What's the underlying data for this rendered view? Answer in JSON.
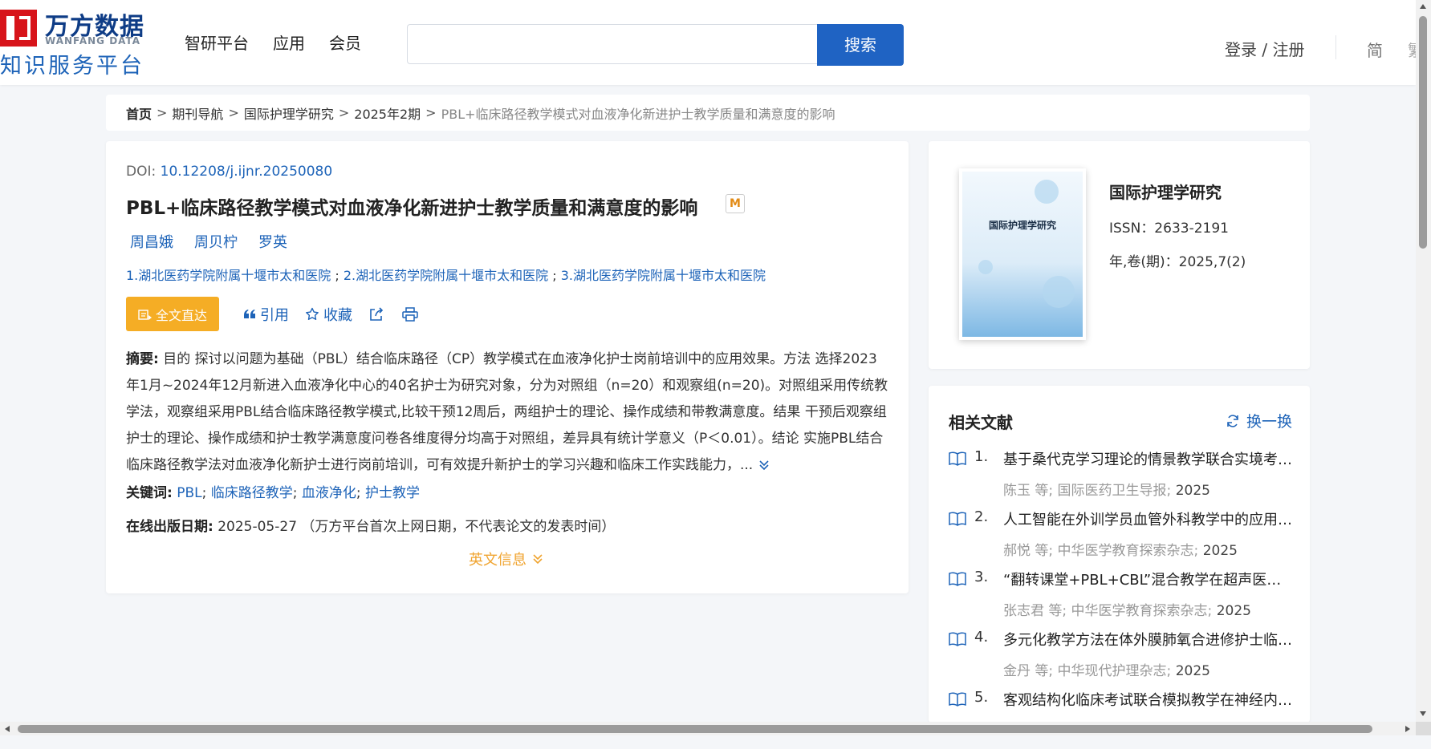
{
  "header": {
    "logo_cn": "万方数据",
    "logo_en": "WANFANG DATA",
    "logo_sub": "知识服务平台",
    "nav": [
      "智研平台",
      "应用",
      "会员"
    ],
    "search_value": "",
    "search_button": "搜索",
    "login": "登录 / 注册",
    "lang_simplified": "简",
    "lang_traditional": "繁"
  },
  "breadcrumb": {
    "home": "首页",
    "items": [
      "期刊导航",
      "国际护理学研究",
      "2025年2期"
    ],
    "current": "PBL+临床路径教学模式对血液净化新进护士教学质量和满意度的影响",
    "separator": ">"
  },
  "article": {
    "doi_label": "DOI:",
    "doi": "10.12208/j.ijnr.20250080",
    "title": "PBL+临床路径教学模式对血液净化新进护士教学质量和满意度的影响",
    "badge": "M",
    "authors": [
      "周昌娥",
      "周贝柠",
      "罗英"
    ],
    "affiliations": [
      "1.湖北医药学院附属十堰市太和医院",
      "2.湖北医药学院附属十堰市太和医院",
      "3.湖北医药学院附属十堰市太和医院"
    ],
    "affil_sep": ";",
    "actions": {
      "fulltext": "全文直达",
      "cite": "引用",
      "favorite": "收藏"
    },
    "abstract_label": "摘要:",
    "abstract_text": "目的 探讨以问题为基础（PBL）结合临床路径（CP）教学模式在血液净化护士岗前培训中的应用效果。方法 选择2023年1月~2024年12月新进入血液净化中心的40名护士为研究对象，分为对照组（n=20）和观察组(n=20)。对照组采用传统教学法，观察组采用PBL结合临床路径教学模式,比较干预12周后，两组护士的理论、操作成绩和带教满意度。结果 干预后观察组护士的理论、操作成绩和护士教学满意度问卷各维度得分均高于对照组，差异具有统计学意义（P＜0.01）。结论 实施PBL结合临床路径教学法对血液净化新护士进行岗前培训，可有效提升新护士的学习兴趣和临床工作实践能力，...",
    "keywords_label": "关键词:",
    "keywords": [
      "PBL",
      "临床路径教学",
      "血液净化",
      "护士教学"
    ],
    "keyword_sep": ";",
    "pubdate_label": "在线出版日期:",
    "pubdate": "2025-05-27",
    "pubdate_note": "（万方平台首次上网日期，不代表论文的发表时间）",
    "english_info": "英文信息"
  },
  "journal": {
    "cover_title": "国际护理学研究",
    "name": "国际护理学研究",
    "issn": "ISSN：2633-2191",
    "volume": "年,卷(期)：2025,7(2)"
  },
  "related": {
    "heading": "相关文献",
    "refresh": "换一换",
    "items": [
      {
        "num": "1.",
        "title": "基于桑代克学习理论的情景教学联合实境考核法在...",
        "authors": "陈玉",
        "etal": "等;",
        "journal": "国际医药卫生导报",
        "year": "2025"
      },
      {
        "num": "2.",
        "title": "人工智能在外训学员血管外科教学中的应用研究",
        "authors": "郝悦",
        "etal": "等;",
        "journal": "中华医学教育探索杂志",
        "year": "2025"
      },
      {
        "num": "3.",
        "title": "“翻转课堂+PBL+CBL”混合教学在超声医学规培中...",
        "authors": "张志君",
        "etal": "等;",
        "journal": "中华医学教育探索杂志",
        "year": "2025"
      },
      {
        "num": "4.",
        "title": "多元化教学方法在体外膜肺氧合进修护士临床带教中...",
        "authors": "金丹",
        "etal": "等;",
        "journal": "中华现代护理杂志",
        "year": "2025"
      },
      {
        "num": "5.",
        "title": "客观结构化临床考试联合模拟教学在神经内科教学中...",
        "authors": "",
        "etal": "",
        "journal": "",
        "year": ""
      }
    ]
  },
  "colors": {
    "brand_red": "#d7141a",
    "brand_blue": "#1f63c3",
    "link": "#1d63b8",
    "fulltext_orange": "#f5ad25"
  }
}
